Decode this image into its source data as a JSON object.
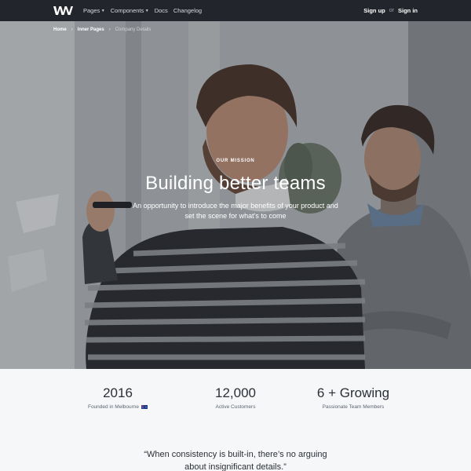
{
  "nav": {
    "logo": "WM",
    "links": [
      {
        "label": "Pages",
        "dropdown": true
      },
      {
        "label": "Components",
        "dropdown": true
      },
      {
        "label": "Docs",
        "dropdown": false
      },
      {
        "label": "Changelog",
        "dropdown": false
      }
    ],
    "signup": "Sign up",
    "or": "or",
    "signin": "Sign in"
  },
  "breadcrumb": {
    "items": [
      "Home",
      "Inner Pages"
    ],
    "current": "Company Details",
    "separator": "›"
  },
  "hero": {
    "eyebrow": "OUR MISSION",
    "title": "Building better teams",
    "subtitle": "An opportunity to introduce the major benefits of your product and set the scene for what’s to come"
  },
  "stats": [
    {
      "value": "2016",
      "label": "Founded in Melbourne",
      "flag": "australia-flag-icon"
    },
    {
      "value": "12,000",
      "label": "Active Customers"
    },
    {
      "value": "6 + Growing",
      "label": "Passionate Team Members"
    }
  ],
  "quote": {
    "line1": "“When consistency is built-in, there’s no arguing",
    "line2": "about insignificant details.”"
  },
  "colors": {
    "navbar": "#22252b",
    "page_bg": "#f6f7f9",
    "text": "#2b2f36"
  }
}
